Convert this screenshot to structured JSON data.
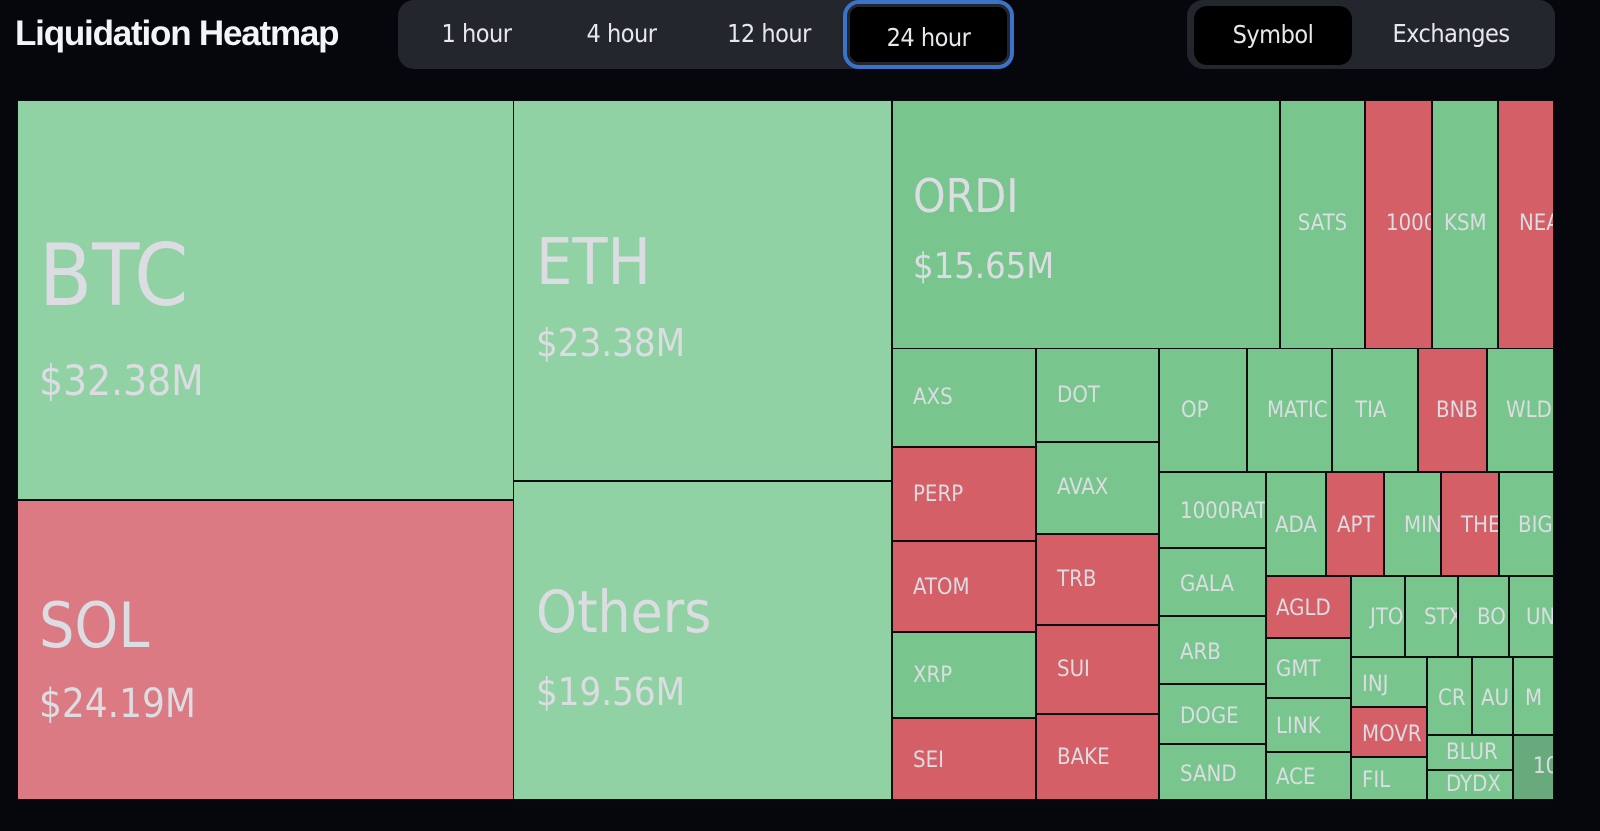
{
  "header": {
    "title": "Liquidation Heatmap",
    "time_ranges": [
      "1 hour",
      "4 hour",
      "12 hour",
      "24 hour"
    ],
    "selected_time_range": "24 hour",
    "views": [
      "Symbol",
      "Exchanges"
    ],
    "selected_view": "Symbol"
  },
  "colors": {
    "long_light": "#90d2a4",
    "long": "#78c68d",
    "long_dark": "#68aa7b",
    "short_light": "#db7a82",
    "short": "#d55f67",
    "background": "#05070c",
    "label": "#dcdde2"
  },
  "chart_data": {
    "type": "treemap",
    "title": "Liquidation Heatmap",
    "period": "24 hour",
    "grouping": "Symbol",
    "cells": [
      {
        "symbol": "BTC",
        "value": "$32.38M",
        "shade": "long_light"
      },
      {
        "symbol": "SOL",
        "value": "$24.19M",
        "shade": "short_light"
      },
      {
        "symbol": "ETH",
        "value": "$23.38M",
        "shade": "long_light"
      },
      {
        "symbol": "Others",
        "value": "$19.56M",
        "shade": "long_light"
      },
      {
        "symbol": "ORDI",
        "value": "$15.65M",
        "shade": "long"
      },
      {
        "symbol": "SATS",
        "shade": "long"
      },
      {
        "symbol": "1000",
        "shade": "short"
      },
      {
        "symbol": "KSM",
        "shade": "long"
      },
      {
        "symbol": "NEA",
        "shade": "short"
      },
      {
        "symbol": "AXS",
        "shade": "long"
      },
      {
        "symbol": "PERP",
        "shade": "short"
      },
      {
        "symbol": "ATOM",
        "shade": "short"
      },
      {
        "symbol": "XRP",
        "shade": "long"
      },
      {
        "symbol": "SEI",
        "shade": "short"
      },
      {
        "symbol": "DOT",
        "shade": "long"
      },
      {
        "symbol": "AVAX",
        "shade": "long"
      },
      {
        "symbol": "TRB",
        "shade": "short"
      },
      {
        "symbol": "SUI",
        "shade": "short"
      },
      {
        "symbol": "BAKE",
        "shade": "short"
      },
      {
        "symbol": "OP",
        "shade": "long"
      },
      {
        "symbol": "MATIC",
        "shade": "long"
      },
      {
        "symbol": "TIA",
        "shade": "long"
      },
      {
        "symbol": "BNB",
        "shade": "short"
      },
      {
        "symbol": "WLD",
        "shade": "long"
      },
      {
        "symbol": "1000RAT",
        "shade": "long"
      },
      {
        "symbol": "GALA",
        "shade": "long"
      },
      {
        "symbol": "ARB",
        "shade": "long"
      },
      {
        "symbol": "DOGE",
        "shade": "long"
      },
      {
        "symbol": "SAND",
        "shade": "long"
      },
      {
        "symbol": "ADA",
        "shade": "long"
      },
      {
        "symbol": "APT",
        "shade": "short"
      },
      {
        "symbol": "MIN",
        "shade": "long"
      },
      {
        "symbol": "THE",
        "shade": "short"
      },
      {
        "symbol": "BIG",
        "shade": "long"
      },
      {
        "symbol": "AGLD",
        "shade": "short"
      },
      {
        "symbol": "GMT",
        "shade": "long"
      },
      {
        "symbol": "LINK",
        "shade": "long"
      },
      {
        "symbol": "ACE",
        "shade": "long"
      },
      {
        "symbol": "JTO",
        "shade": "long"
      },
      {
        "symbol": "STX",
        "shade": "long"
      },
      {
        "symbol": "BO",
        "shade": "long"
      },
      {
        "symbol": "UN",
        "shade": "long"
      },
      {
        "symbol": "INJ",
        "shade": "long"
      },
      {
        "symbol": "MOVR",
        "shade": "short"
      },
      {
        "symbol": "FIL",
        "shade": "long"
      },
      {
        "symbol": "CR",
        "shade": "long"
      },
      {
        "symbol": "AU",
        "shade": "long"
      },
      {
        "symbol": "M",
        "shade": "long"
      },
      {
        "symbol": "BLUR",
        "shade": "long"
      },
      {
        "symbol": "DYDX",
        "shade": "long"
      },
      {
        "symbol": "10",
        "shade": "long_dark"
      }
    ]
  }
}
